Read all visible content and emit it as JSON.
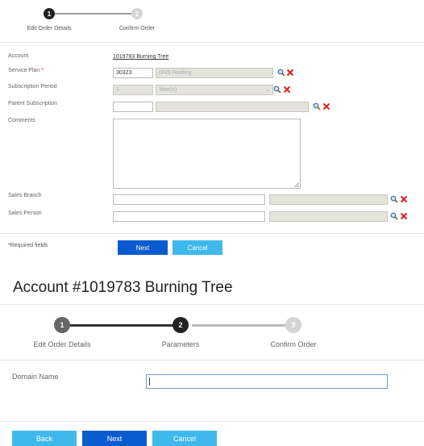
{
  "order_wizard": {
    "steps": [
      {
        "number": "1",
        "label": "Edit Order Details"
      },
      {
        "number": "2",
        "label": "Confirm Order"
      }
    ]
  },
  "order_form": {
    "account_label": "Account",
    "account_number": "1019783",
    "account_name": "Burning Tree",
    "service_plan_label": "Service Plan",
    "required_marker": "*",
    "service_plan_id": "30323",
    "service_plan_name": "DNS Hosting",
    "subscription_period_label": "Subscription Period",
    "subscription_period_value": "1",
    "subscription_period_unit": "Year(s)",
    "parent_subscription_label": "Parent Subscription",
    "parent_subscription_id": "",
    "parent_subscription_name": "",
    "comments_label": "Comments",
    "comments_value": "",
    "sales_branch_label": "Sales Branch",
    "sales_branch_id": "",
    "sales_branch_name": "",
    "sales_person_label": "Sales Person",
    "sales_person_id": "",
    "sales_person_name": "",
    "required_fields_note": "*Required fields",
    "next_label": "Next",
    "cancel_label": "Cancel"
  },
  "param_page": {
    "title": "Account #1019783 Burning Tree",
    "steps": [
      {
        "number": "1",
        "label": "Edit Order Details"
      },
      {
        "number": "2",
        "label": "Parameters"
      },
      {
        "number": "3",
        "label": "Confirm Order"
      }
    ],
    "domain_name_label": "Domain Name",
    "domain_name_value": "",
    "back_label": "Back",
    "next_label": "Next",
    "cancel_label": "Cancel"
  },
  "colors": {
    "primary_button": "#0a5bd0",
    "secondary_button": "#3fb9ec",
    "delete_icon": "#e02020",
    "search_icon": "#3a6ea5",
    "step_active": "#222222",
    "step_done": "#666666",
    "step_inactive": "#d4d4d4"
  },
  "icons": {
    "lookup": "magnifier-icon",
    "clear": "red-x-icon",
    "dropdown": "chevron-down-icon"
  }
}
